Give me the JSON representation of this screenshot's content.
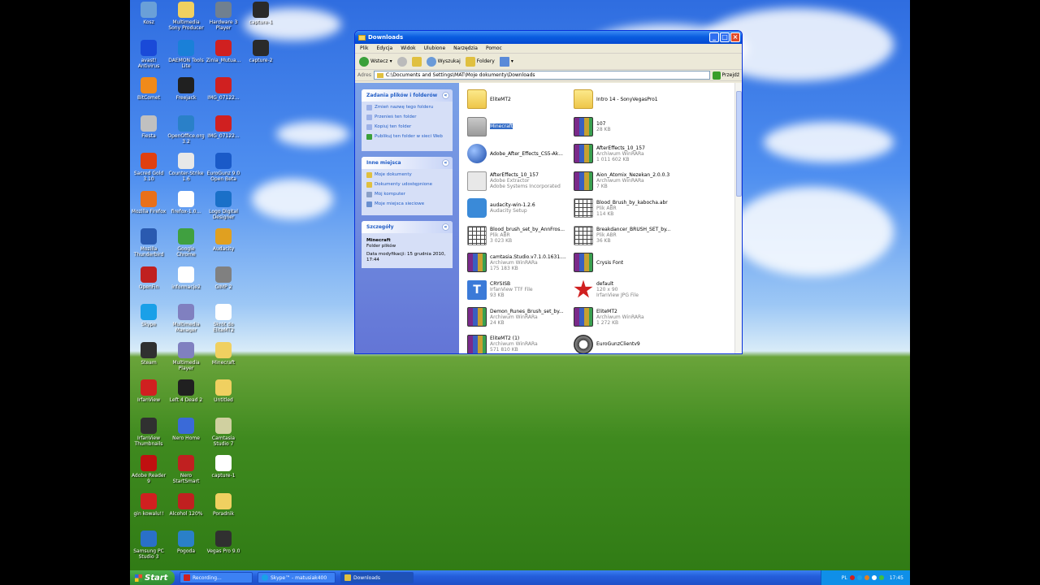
{
  "desktop": {
    "icons": [
      {
        "label": "Kosz",
        "color": "#6aa0d8"
      },
      {
        "label": "Multimedia Sony Producer",
        "color": "#f0d060"
      },
      {
        "label": "Hardware 3 Player",
        "color": "#708090"
      },
      {
        "label": "capture-1",
        "color": "#2a2a2a"
      },
      {
        "label": "avast! Antivirus",
        "color": "#1a4ad8"
      },
      {
        "label": "DAEMON Tools Lite",
        "color": "#1a80d8"
      },
      {
        "label": "Zinia_Mutua...",
        "color": "#d02020"
      },
      {
        "label": "capture-2",
        "color": "#2a2a2a"
      },
      {
        "label": "BitComet",
        "color": "#f08a1a"
      },
      {
        "label": "Freejack",
        "color": "#202020"
      },
      {
        "label": "IMG_07122...",
        "color": "#d02020"
      },
      {
        "label": "Fiesta",
        "color": "#c0c0c0"
      },
      {
        "label": "OpenOffice.org 3.2",
        "color": "#2a80c8"
      },
      {
        "label": "IMG_07122...",
        "color": "#d02020"
      },
      {
        "label": "Sacred Gold 3.10",
        "color": "#e04010"
      },
      {
        "label": "Counter-Strike 1.6",
        "color": "#e8e8e8"
      },
      {
        "label": "EuroGunz 9.0 Open Beta",
        "color": "#1a5ac8"
      },
      {
        "label": "Mozilla Firefox",
        "color": "#e8701a"
      },
      {
        "label": "firefox-1.0...",
        "color": "#ffffff"
      },
      {
        "label": "Logo Digital Designer",
        "color": "#1a70c8"
      },
      {
        "label": "Mozilla Thunderbird",
        "color": "#2a5ab0"
      },
      {
        "label": "Google Chrome",
        "color": "#40a040"
      },
      {
        "label": "Audacity",
        "color": "#e0a020"
      },
      {
        "label": "OpenFin",
        "color": "#c02020"
      },
      {
        "label": "informacje2",
        "color": "#ffffff"
      },
      {
        "label": "GIMP 2",
        "color": "#808080"
      },
      {
        "label": "Skype",
        "color": "#1aa0e8"
      },
      {
        "label": "Multimedia Manager",
        "color": "#8080c0"
      },
      {
        "label": "Skrót do EliteMT2",
        "color": "#ffffff"
      },
      {
        "label": "Steam",
        "color": "#303030"
      },
      {
        "label": "Multimedia Player",
        "color": "#8080c0"
      },
      {
        "label": "Minecraft",
        "color": "#f0d060"
      },
      {
        "label": "IrfanView",
        "color": "#d02020"
      },
      {
        "label": "Left 4 Dead 2",
        "color": "#202020"
      },
      {
        "label": "Untitled",
        "color": "#f0d060"
      },
      {
        "label": "IrfanView Thumbnails",
        "color": "#303030"
      },
      {
        "label": "Nero Home",
        "color": "#3a6ad8"
      },
      {
        "label": "Camtasia Studio 7",
        "color": "#d0d0a0"
      },
      {
        "label": "Adobe Reader 9",
        "color": "#c01010"
      },
      {
        "label": "Nero StartSmart",
        "color": "#c02020"
      },
      {
        "label": "capture-1",
        "color": "#ffffff"
      },
      {
        "label": "gin kowalu!!",
        "color": "#d02020"
      },
      {
        "label": "Alcohol 120%",
        "color": "#c02020"
      },
      {
        "label": "Poradnik",
        "color": "#f0d060"
      },
      {
        "label": "Samsung PC Studio 3",
        "color": "#2a70c8"
      },
      {
        "label": "Pogoda",
        "color": "#2a80c8"
      },
      {
        "label": "Vegas Pro 9.0",
        "color": "#303030"
      }
    ]
  },
  "window": {
    "title": "Downloads",
    "menu": [
      "Plik",
      "Edycja",
      "Widok",
      "Ulubione",
      "Narzędzia",
      "Pomoc"
    ],
    "toolbar": {
      "back": "Wstecz",
      "search": "Wyszukaj",
      "folders": "Foldery"
    },
    "address": {
      "label": "Adres",
      "value": "C:\\Documents and Settings\\MAT\\Moje dokumenty\\Downloads",
      "go": "Przejdź"
    },
    "taskpane": {
      "tasks": {
        "title": "Zadania plików i folderów",
        "items": [
          "Zmień nazwę tego folderu",
          "Przenieś ten folder",
          "Kopiuj ten folder",
          "Publikuj ten folder w sieci Web"
        ]
      },
      "places": {
        "title": "Inne miejsca",
        "items": [
          "Moje dokumenty",
          "Dokumenty udostępnione",
          "Mój komputer",
          "Moje miejsca sieciowe"
        ]
      },
      "details": {
        "title": "Szczegóły",
        "name": "Minecraft",
        "type": "Folder plików",
        "modified": "Data modyfikacji: 15 grudnia 2010, 17:44"
      }
    },
    "files": [
      {
        "name": "EliteMT2",
        "sub1": "",
        "sub2": "",
        "icon": "folder"
      },
      {
        "name": "Intro 14 - SonyVegasPro1",
        "sub1": "",
        "sub2": "",
        "icon": "folder"
      },
      {
        "name": "Minecraft",
        "sub1": "",
        "sub2": "",
        "icon": "folder grey",
        "selected": true
      },
      {
        "name": "107",
        "sub1": "28 KB",
        "sub2": "",
        "icon": "rar"
      },
      {
        "name": "Adobe_After_Effects_CS5-Ak...",
        "sub1": "",
        "sub2": "",
        "icon": "globe"
      },
      {
        "name": "AfterEffects_10_157",
        "sub1": "Archiwum WinRARa",
        "sub2": "1 011 602 KB",
        "icon": "rar"
      },
      {
        "name": "AfterEffects_10_157",
        "sub1": "Adobe Extractor",
        "sub2": "Adobe Systems Incorporated",
        "icon": "ae"
      },
      {
        "name": "Aion_Atomix_Nezekan_2.0.0.3",
        "sub1": "Archiwum WinRARa",
        "sub2": "7 KB",
        "icon": "rar"
      },
      {
        "name": "audacity-win-1.2.6",
        "sub1": "Audacity Setup",
        "sub2": "",
        "icon": "setup"
      },
      {
        "name": "Blood_Brush_by_kabocha.abr",
        "sub1": "Plik ABR",
        "sub2": "114 KB",
        "icon": "grid"
      },
      {
        "name": "Blood_brush_set_by_AnnFros...",
        "sub1": "Plik ABR",
        "sub2": "3 023 KB",
        "icon": "grid"
      },
      {
        "name": "Breakdancer_BRUSH_SET_by...",
        "sub1": "Plik ABR",
        "sub2": "36 KB",
        "icon": "grid"
      },
      {
        "name": "camtasia.Studio.v7.1.0.1631....",
        "sub1": "Archiwum WinRARa",
        "sub2": "175 183 KB",
        "icon": "rar"
      },
      {
        "name": "Crysis Font",
        "sub1": "",
        "sub2": "",
        "icon": "rar"
      },
      {
        "name": "CRYSISB",
        "sub1": "IrfanView TTF File",
        "sub2": "93 KB",
        "icon": "tt"
      },
      {
        "name": "default",
        "sub1": "120 x 90",
        "sub2": "IrfanView JPG File",
        "icon": "star"
      },
      {
        "name": "Demon_Runes_Brush_set_by...",
        "sub1": "Archiwum WinRARa",
        "sub2": "24 KB",
        "icon": "rar"
      },
      {
        "name": "EliteMT2",
        "sub1": "Archiwum WinRARa",
        "sub2": "1 272 KB",
        "icon": "rar"
      },
      {
        "name": "EliteMT2 (1)",
        "sub1": "Archiwum WinRARa",
        "sub2": "571 810 KB",
        "icon": "rar"
      },
      {
        "name": "EuroGunzClientv9",
        "sub1": "",
        "sub2": "",
        "icon": "gear"
      }
    ]
  },
  "taskbar": {
    "start": "Start",
    "tasks": [
      "Recording...",
      "Skype™ - matusiak400",
      "Downloads"
    ],
    "lang": "PL",
    "clock": "17:45"
  }
}
